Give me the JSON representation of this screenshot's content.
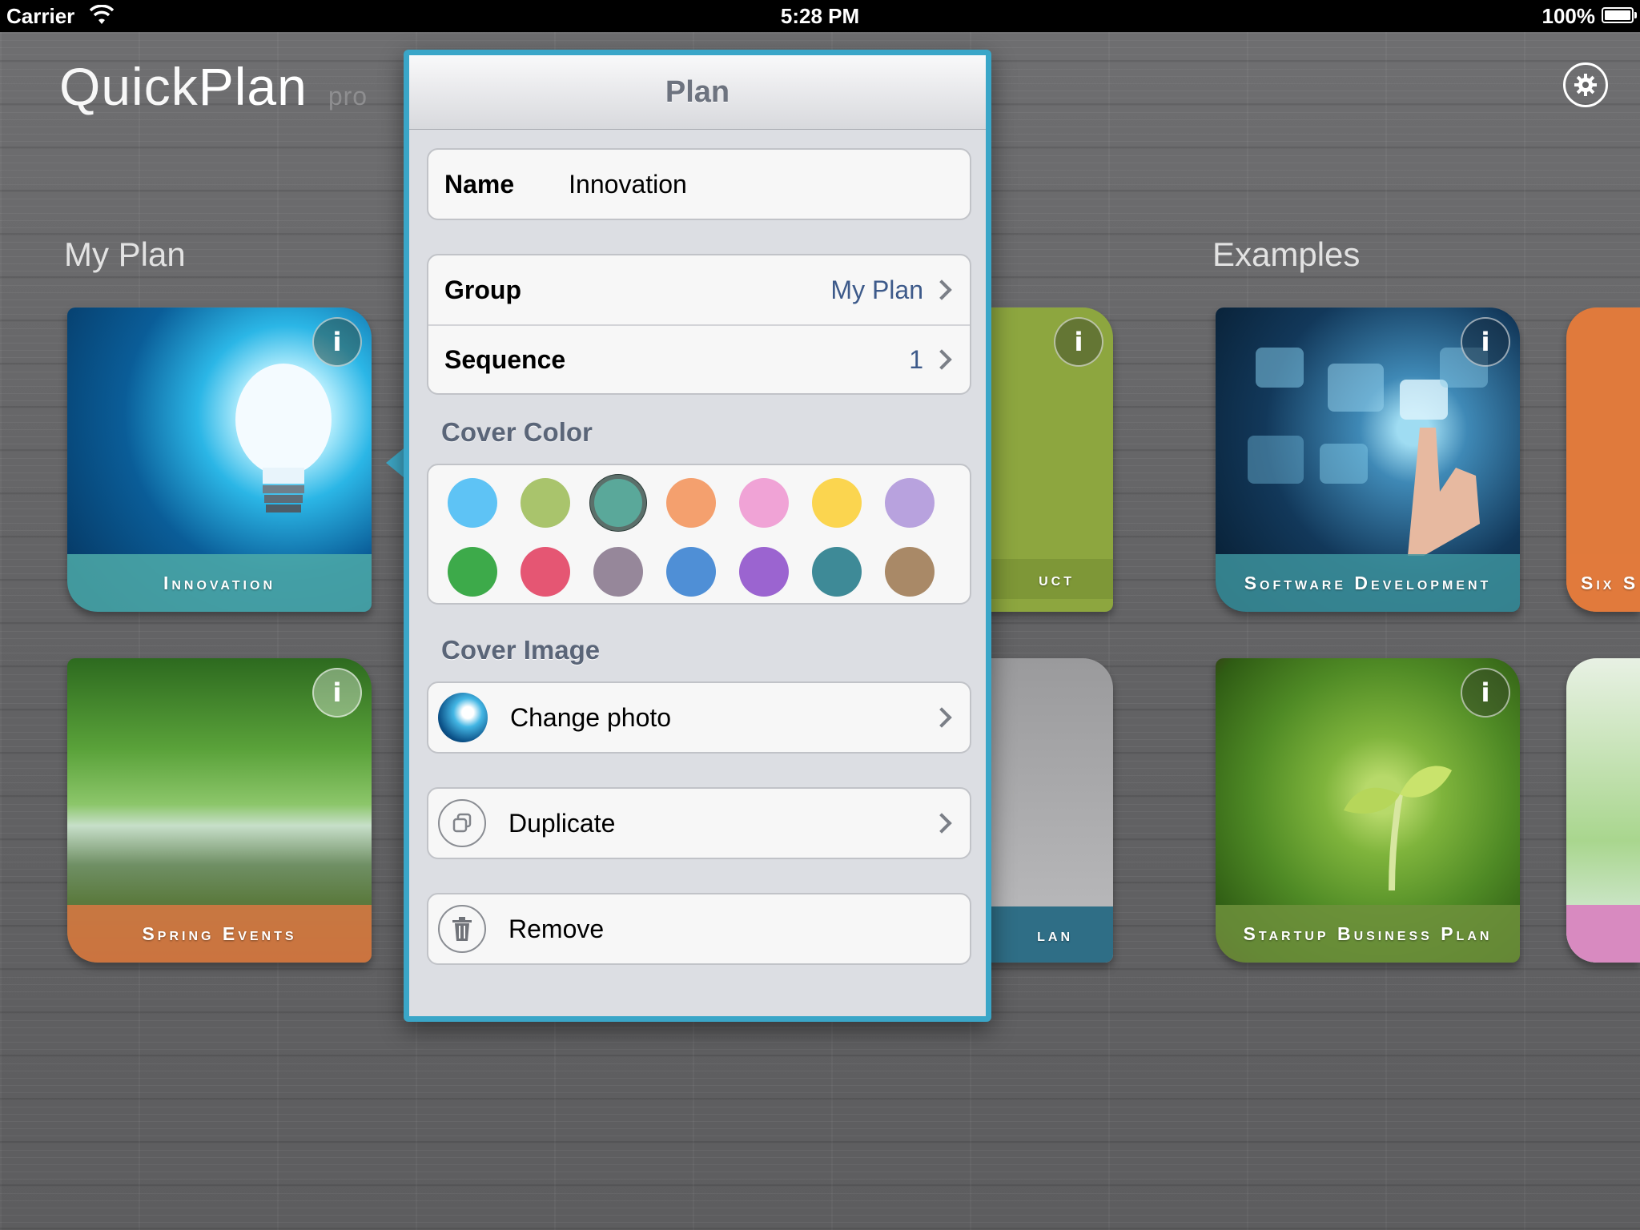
{
  "status_bar": {
    "carrier": "Carrier",
    "time": "5:28 PM",
    "battery": "100%"
  },
  "app": {
    "logo_quick": "Quick",
    "logo_plan": "Plan",
    "logo_pro": "pro"
  },
  "sections": {
    "my_plan": "My Plan",
    "examples": "Examples"
  },
  "cards": {
    "innovation": "Innovation",
    "spring_events": "Spring Events",
    "partial_product": "uct",
    "partial_plan": "lan",
    "software_development": "Software Development",
    "six_sigma_partial": "Six S",
    "startup_business_plan": "Startup Business Plan",
    "info_glyph": "i"
  },
  "popover": {
    "title": "Plan",
    "name_label": "Name",
    "name_value": "Innovation",
    "group_label": "Group",
    "group_value": "My Plan",
    "sequence_label": "Sequence",
    "sequence_value": "1",
    "cover_color_heading": "Cover Color",
    "cover_image_heading": "Cover Image",
    "change_photo": "Change photo",
    "duplicate": "Duplicate",
    "remove": "Remove"
  },
  "cover_colors": [
    "#5ec3f5",
    "#a9c46c",
    "#5aa89a",
    "#f4a06e",
    "#f0a3d6",
    "#fbd54f",
    "#b8a2de",
    "#3daa4a",
    "#e55673",
    "#96879a",
    "#4f8fd6",
    "#9b64d0",
    "#3e8a97",
    "#a98967"
  ],
  "selected_color_index": 2,
  "icons": {
    "wifi": "wifi-icon",
    "battery": "battery-icon",
    "settings": "gear-icon",
    "info": "info-icon",
    "chevron": "chevron-right-icon",
    "duplicate": "duplicate-icon",
    "trash": "trash-icon"
  }
}
